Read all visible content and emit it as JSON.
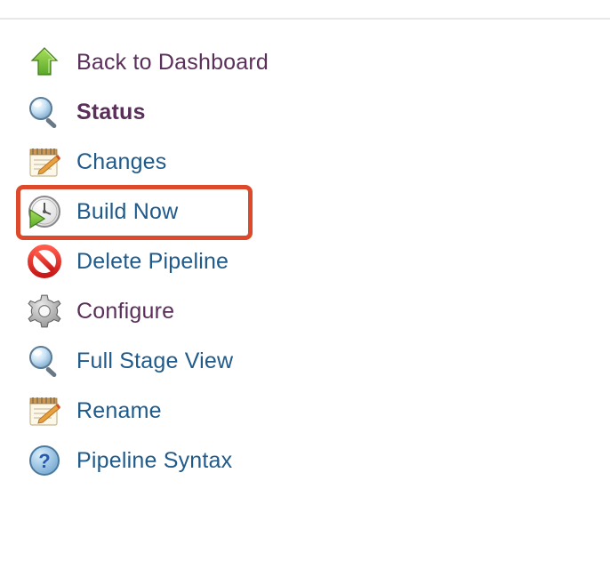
{
  "sidebar": {
    "items": [
      {
        "label": "Back to Dashboard"
      },
      {
        "label": "Status"
      },
      {
        "label": "Changes"
      },
      {
        "label": "Build Now"
      },
      {
        "label": "Delete Pipeline"
      },
      {
        "label": "Configure"
      },
      {
        "label": "Full Stage View"
      },
      {
        "label": "Rename"
      },
      {
        "label": "Pipeline Syntax"
      }
    ]
  }
}
